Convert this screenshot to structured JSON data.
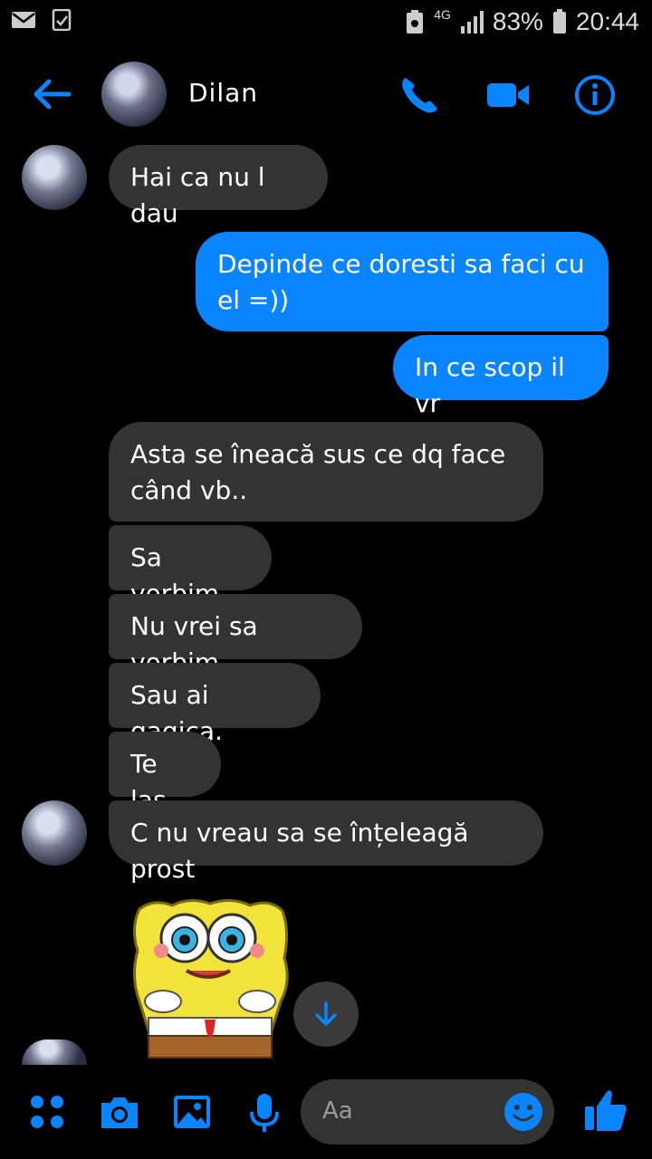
{
  "status_bar": {
    "network": "4G",
    "battery": "83%",
    "time": "20:44"
  },
  "header": {
    "contact_name": "Dilan"
  },
  "messages": [
    {
      "text": "Hai ca nu l dau",
      "dir": "in"
    },
    {
      "text": "Depinde ce doresti sa faci cu el =))",
      "dir": "out"
    },
    {
      "text": "In ce scop il vr",
      "dir": "out"
    },
    {
      "text": "Asta se îneacă sus ce dq face când vb..",
      "dir": "in"
    },
    {
      "text": "Sa vorbim",
      "dir": "in"
    },
    {
      "text": "Nu vrei sa vorbim",
      "dir": "in"
    },
    {
      "text": "Sau ai gagica.",
      "dir": "in"
    },
    {
      "text": "Te las",
      "dir": "in"
    },
    {
      "text": "C nu vreau sa se înțeleagă prost",
      "dir": "in"
    }
  ],
  "composer": {
    "placeholder": "Aa"
  },
  "colors": {
    "accent": "#0a84ff",
    "incoming_bubble": "#333333",
    "background": "#000000"
  }
}
